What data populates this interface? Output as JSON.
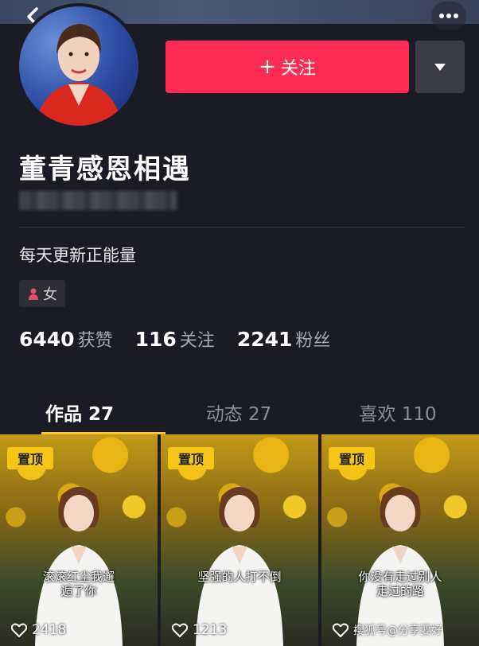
{
  "header": {
    "back_icon": "chevron-left-icon",
    "more_icon": "more-dots-icon"
  },
  "profile": {
    "name": "董青感恩相遇",
    "bio": "每天更新正能量",
    "gender": "女",
    "follow_button_label": "关注",
    "follow_button_color": "#fe2c55"
  },
  "stats": [
    {
      "value": "6440",
      "label": "获赞"
    },
    {
      "value": "116",
      "label": "关注"
    },
    {
      "value": "2241",
      "label": "粉丝"
    }
  ],
  "tabs": [
    {
      "label": "作品 27",
      "active": true
    },
    {
      "label": "动态 27",
      "active": false
    },
    {
      "label": "喜欢 110",
      "active": false
    }
  ],
  "accent_color": "#f5c518",
  "videos": [
    {
      "badge": "置顶",
      "caption_line1": "滚滚红尘我邂",
      "caption_line2": "逅了你",
      "likes": "2418"
    },
    {
      "badge": "置顶",
      "caption_line1": "坚强的人打不倒",
      "caption_line2": "",
      "likes": "1213"
    },
    {
      "badge": "置顶",
      "caption_line1": "你没有走过别人",
      "caption_line2": "走过的路",
      "likes": "4"
    }
  ],
  "watermark": "搜狐号@分享要好"
}
